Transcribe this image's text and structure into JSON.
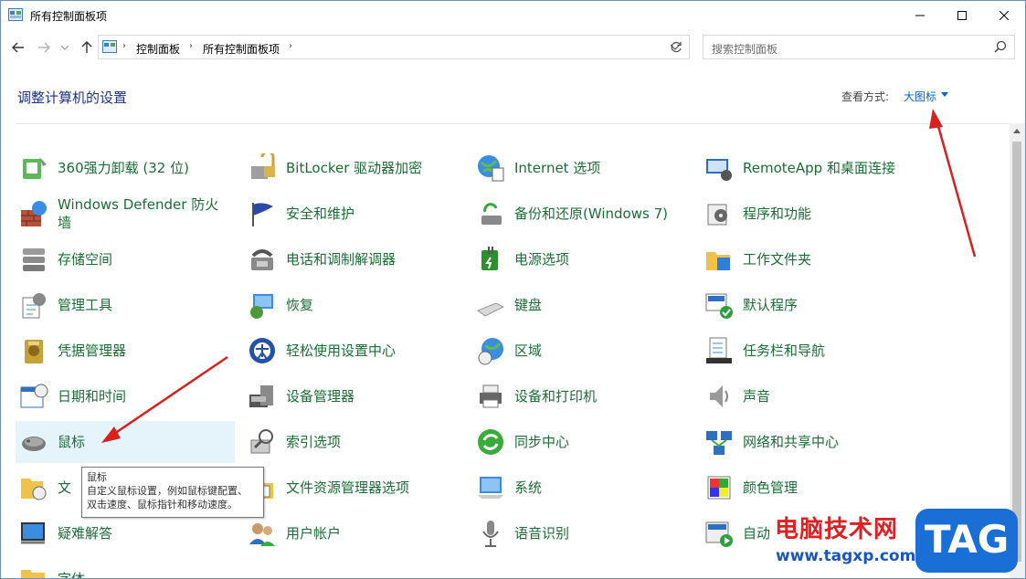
{
  "window": {
    "title": "所有控制面板项",
    "controls": {
      "minimize": "minimize-icon",
      "maximize": "maximize-icon",
      "close": "close-icon"
    }
  },
  "address": {
    "crumbs": [
      "控制面板",
      "所有控制面板项"
    ],
    "search_placeholder": "搜索控制面板"
  },
  "header": {
    "title": "调整计算机的设置",
    "view_by_label": "查看方式:",
    "view_by_value": "大图标"
  },
  "items": [
    {
      "label": "360强力卸载 (32 位)",
      "icon": "uninstall-icon"
    },
    {
      "label": "BitLocker 驱动器加密",
      "icon": "bitlocker-icon"
    },
    {
      "label": "Internet 选项",
      "icon": "internet-options-icon"
    },
    {
      "label": "RemoteApp 和桌面连接",
      "icon": "remoteapp-icon"
    },
    {
      "label": "Windows Defender 防火墙",
      "icon": "firewall-icon"
    },
    {
      "label": "安全和维护",
      "icon": "flag-icon"
    },
    {
      "label": "备份和还原(Windows 7)",
      "icon": "backup-icon"
    },
    {
      "label": "程序和功能",
      "icon": "programs-icon"
    },
    {
      "label": "存储空间",
      "icon": "storage-icon"
    },
    {
      "label": "电话和调制解调器",
      "icon": "phone-modem-icon"
    },
    {
      "label": "电源选项",
      "icon": "power-icon"
    },
    {
      "label": "工作文件夹",
      "icon": "work-folder-icon"
    },
    {
      "label": "管理工具",
      "icon": "admin-tools-icon"
    },
    {
      "label": "恢复",
      "icon": "recovery-icon"
    },
    {
      "label": "键盘",
      "icon": "keyboard-icon"
    },
    {
      "label": "默认程序",
      "icon": "default-programs-icon"
    },
    {
      "label": "凭据管理器",
      "icon": "credential-icon"
    },
    {
      "label": "轻松使用设置中心",
      "icon": "ease-of-access-icon"
    },
    {
      "label": "区域",
      "icon": "region-icon"
    },
    {
      "label": "任务栏和导航",
      "icon": "taskbar-icon"
    },
    {
      "label": "日期和时间",
      "icon": "calendar-clock-icon"
    },
    {
      "label": "设备管理器",
      "icon": "device-manager-icon"
    },
    {
      "label": "设备和打印机",
      "icon": "printer-icon"
    },
    {
      "label": "声音",
      "icon": "speaker-icon"
    },
    {
      "label": "鼠标",
      "icon": "mouse-icon"
    },
    {
      "label": "索引选项",
      "icon": "indexing-icon"
    },
    {
      "label": "同步中心",
      "icon": "sync-icon"
    },
    {
      "label": "网络和共享中心",
      "icon": "network-icon"
    },
    {
      "label": "文",
      "icon": "file-history-icon"
    },
    {
      "label": "文件资源管理器选项",
      "icon": "folder-options-icon"
    },
    {
      "label": "系统",
      "icon": "system-icon"
    },
    {
      "label": "颜色管理",
      "icon": "color-management-icon"
    },
    {
      "label": "疑难解答",
      "icon": "troubleshoot-icon"
    },
    {
      "label": "用户帐户",
      "icon": "user-accounts-icon"
    },
    {
      "label": "语音识别",
      "icon": "microphone-icon"
    },
    {
      "label": "自动",
      "icon": "autoplay-icon"
    },
    {
      "label": "字体",
      "icon": "fonts-icon"
    }
  ],
  "tooltip": {
    "title": "鼠标",
    "line1": "自定义鼠标设置，例如鼠标键配置、",
    "line2": "双击速度、鼠标指针和移动速度。"
  },
  "watermark": {
    "text": "电脑技术网",
    "url": "www.tagxp.com",
    "badge": "TAG"
  },
  "colors": {
    "link_green": "#1a6e35",
    "title_blue": "#1e3287",
    "accent_blue": "#0066cc",
    "arrow_red": "#d9201f",
    "hover": "#e5f3fb"
  }
}
